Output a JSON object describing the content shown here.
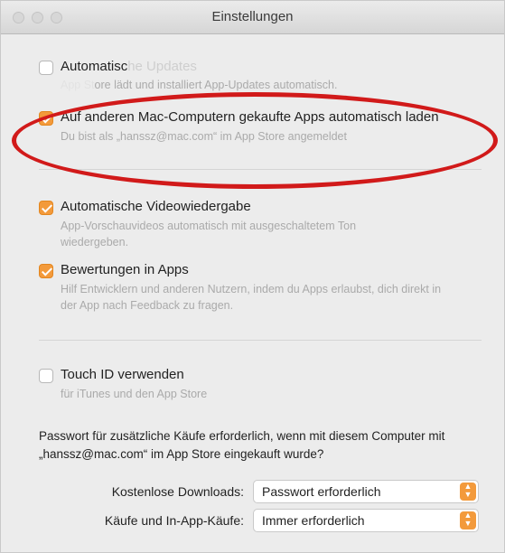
{
  "window": {
    "title": "Einstellungen"
  },
  "options": [
    {
      "label": "Automatische Updates",
      "visible_label": "Automati… Updates",
      "desc": "App Store lädt und installiert App-Updates automatisch.",
      "checked": false
    },
    {
      "label": "Auf anderen Mac-Computern gekaufte Apps automatisch laden",
      "desc": "Du bist als „hanssz@mac.com“ im App Store angemeldet",
      "checked": true
    },
    {
      "label": "Automatische Videowiedergabe",
      "desc": "App-Vorschauvideos automatisch mit ausgeschaltetem Ton wiedergeben.",
      "checked": true
    },
    {
      "label": "Bewertungen in Apps",
      "desc": "Hilf Entwicklern und anderen Nutzern, indem du Apps erlaubst, dich direkt in der App nach Feedback zu fragen.",
      "checked": true
    },
    {
      "label": "Touch ID verwenden",
      "desc": "für iTunes und den App Store",
      "checked": false
    }
  ],
  "password_note": "Passwort für zusätzliche Käufe erforderlich, wenn mit diesem Computer mit „hanssz@mac.com“ im App Store eingekauft wurde?",
  "free_downloads": {
    "label": "Kostenlose Downloads:",
    "value": "Passwort erforderlich"
  },
  "purchases": {
    "label": "Käufe und In-App-Käufe:",
    "value": "Immer erforderlich"
  },
  "annotation_color": "#d11a1a",
  "accent_color": "#f39a3b"
}
